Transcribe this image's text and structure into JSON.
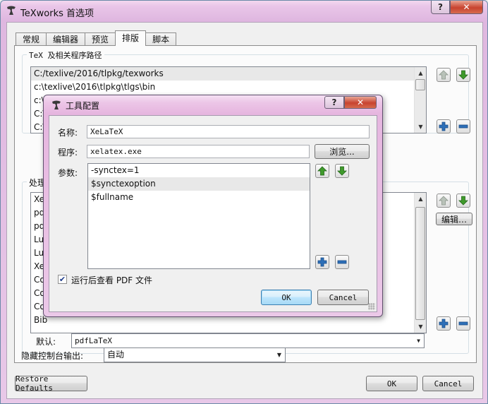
{
  "window": {
    "title": "TeXworks 首选项",
    "help": "?",
    "close": "✕"
  },
  "tabs": [
    "常规",
    "编辑器",
    "预览",
    "排版",
    "脚本"
  ],
  "paths": {
    "label": "TeX 及相关程序路径",
    "items": [
      "C:/texlive/2016/tlpkg/texworks",
      "c:\\texlive\\2016\\tlpkg\\tlgs\\bin",
      "c:\\",
      "C:\\",
      "C:\\"
    ]
  },
  "processing": {
    "label": "处理",
    "items": [
      "Xe",
      "pdf",
      "pdf",
      "Lua",
      "Lua",
      "XeV",
      "Co",
      "Co",
      "Co",
      "Bib"
    ],
    "edit_button": "编辑…"
  },
  "default_engine": {
    "label": "默认:",
    "value": "pdfLaTeX"
  },
  "console": {
    "label": "隐藏控制台输出:",
    "value": "自动"
  },
  "buttons": {
    "restore": "Restore Defaults",
    "ok": "OK",
    "cancel": "Cancel"
  },
  "dialog": {
    "title": "工具配置",
    "help": "?",
    "close": "✕",
    "name_label": "名称:",
    "name_value": "XeLaTeX",
    "program_label": "程序:",
    "program_value": "xelatex.exe",
    "browse": "浏览...",
    "args_label": "参数:",
    "args": [
      "-synctex=1",
      "$synctexoption",
      "$fullname"
    ],
    "view_pdf_label": "运行后查看 PDF 文件",
    "view_pdf_checked": true,
    "ok": "OK",
    "cancel": "Cancel"
  },
  "colors": {
    "arrow_green": "#3f9a2b",
    "plus_blue": "#2d6fb8"
  }
}
